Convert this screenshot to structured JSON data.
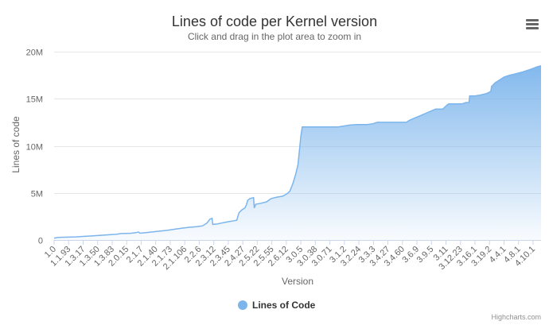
{
  "chart_data": {
    "type": "area",
    "title": "Lines of code per Kernel version",
    "subtitle": "Click and drag in the plot area to zoom in",
    "xlabel": "Version",
    "ylabel": "Lines of code",
    "ylim": [
      0,
      20000000
    ],
    "yticks": [
      {
        "value": 0,
        "label": "0"
      },
      {
        "value": 5000000,
        "label": "5M"
      },
      {
        "value": 10000000,
        "label": "10M"
      },
      {
        "value": 15000000,
        "label": "15M"
      },
      {
        "value": 20000000,
        "label": "20M"
      }
    ],
    "categories": [
      "1.0",
      "1.1.93",
      "1.3.17",
      "1.3.50",
      "1.3.83",
      "2.0.15",
      "2.1.7",
      "2.1.40",
      "2.1.73",
      "2.1.106",
      "2.2.6",
      "2.3.12",
      "2.3.45",
      "2.4.27",
      "2.5.22",
      "2.5.55",
      "2.6.12",
      "3.0.5",
      "3.0.38",
      "3.0.71",
      "3.1.2",
      "3.2.24",
      "3.3.3",
      "3.4.27",
      "3.4.60",
      "3.6.9",
      "3.9.5",
      "3.11",
      "3.12.23",
      "3.16.1",
      "3.19.2",
      "4.4.1",
      "4.8.1",
      "4.10.1"
    ],
    "grid": true,
    "legend_position": "bottom-center",
    "series": [
      {
        "name": "Lines of Code",
        "color": "#7cb5ec",
        "points": [
          [
            0,
            200000
          ],
          [
            0.3,
            280000
          ],
          [
            1,
            300000
          ],
          [
            1.5,
            330000
          ],
          [
            2,
            380000
          ],
          [
            2.5,
            420000
          ],
          [
            3,
            470000
          ],
          [
            3.5,
            520000
          ],
          [
            4,
            580000
          ],
          [
            4.3,
            620000
          ],
          [
            4.6,
            680000
          ],
          [
            5,
            700000
          ],
          [
            5.3,
            720000
          ],
          [
            5.6,
            780000
          ],
          [
            5.8,
            850000
          ],
          [
            5.9,
            720000
          ],
          [
            6.3,
            780000
          ],
          [
            6.8,
            860000
          ],
          [
            7.3,
            950000
          ],
          [
            7.8,
            1030000
          ],
          [
            8.3,
            1150000
          ],
          [
            8.8,
            1260000
          ],
          [
            9.3,
            1350000
          ],
          [
            9.8,
            1420000
          ],
          [
            10.2,
            1500000
          ],
          [
            10.5,
            1800000
          ],
          [
            10.7,
            2200000
          ],
          [
            10.85,
            2300000
          ],
          [
            10.9,
            1650000
          ],
          [
            11.2,
            1700000
          ],
          [
            11.5,
            1800000
          ],
          [
            12.0,
            1950000
          ],
          [
            12.4,
            2050000
          ],
          [
            12.55,
            2100000
          ],
          [
            12.7,
            2900000
          ],
          [
            12.9,
            3200000
          ],
          [
            13.1,
            3400000
          ],
          [
            13.2,
            3700000
          ],
          [
            13.3,
            4200000
          ],
          [
            13.45,
            4400000
          ],
          [
            13.7,
            4500000
          ],
          [
            13.75,
            3400000
          ],
          [
            13.85,
            3800000
          ],
          [
            14.2,
            3900000
          ],
          [
            14.6,
            4050000
          ],
          [
            14.9,
            4400000
          ],
          [
            15.3,
            4550000
          ],
          [
            15.7,
            4650000
          ],
          [
            16.0,
            4900000
          ],
          [
            16.2,
            5200000
          ],
          [
            16.4,
            6000000
          ],
          [
            16.6,
            7000000
          ],
          [
            16.75,
            8000000
          ],
          [
            16.85,
            9500000
          ],
          [
            16.95,
            11000000
          ],
          [
            17.05,
            12000000
          ],
          [
            17.5,
            12000000
          ],
          [
            18.5,
            12000000
          ],
          [
            19.5,
            12000000
          ],
          [
            19.9,
            12100000
          ],
          [
            20.3,
            12200000
          ],
          [
            20.8,
            12250000
          ],
          [
            21.5,
            12250000
          ],
          [
            21.9,
            12350000
          ],
          [
            22.2,
            12500000
          ],
          [
            23.0,
            12500000
          ],
          [
            23.8,
            12500000
          ],
          [
            24.2,
            12500000
          ],
          [
            24.4,
            12700000
          ],
          [
            24.7,
            12900000
          ],
          [
            25.0,
            13100000
          ],
          [
            25.3,
            13300000
          ],
          [
            25.6,
            13500000
          ],
          [
            25.9,
            13700000
          ],
          [
            26.2,
            13900000
          ],
          [
            26.7,
            13900000
          ],
          [
            26.9,
            14200000
          ],
          [
            27.1,
            14450000
          ],
          [
            27.5,
            14450000
          ],
          [
            28.0,
            14450000
          ],
          [
            28.3,
            14600000
          ],
          [
            28.5,
            14600000
          ],
          [
            28.55,
            15300000
          ],
          [
            28.9,
            15300000
          ],
          [
            29.3,
            15400000
          ],
          [
            29.7,
            15550000
          ],
          [
            29.9,
            15700000
          ],
          [
            30.0,
            15800000
          ],
          [
            30.05,
            16300000
          ],
          [
            30.3,
            16700000
          ],
          [
            30.6,
            17000000
          ],
          [
            30.9,
            17300000
          ],
          [
            31.3,
            17500000
          ],
          [
            31.7,
            17650000
          ],
          [
            32.2,
            17850000
          ],
          [
            32.7,
            18100000
          ],
          [
            33.2,
            18400000
          ],
          [
            33.45,
            18500000
          ]
        ]
      }
    ]
  },
  "credits": "Highcharts.com"
}
